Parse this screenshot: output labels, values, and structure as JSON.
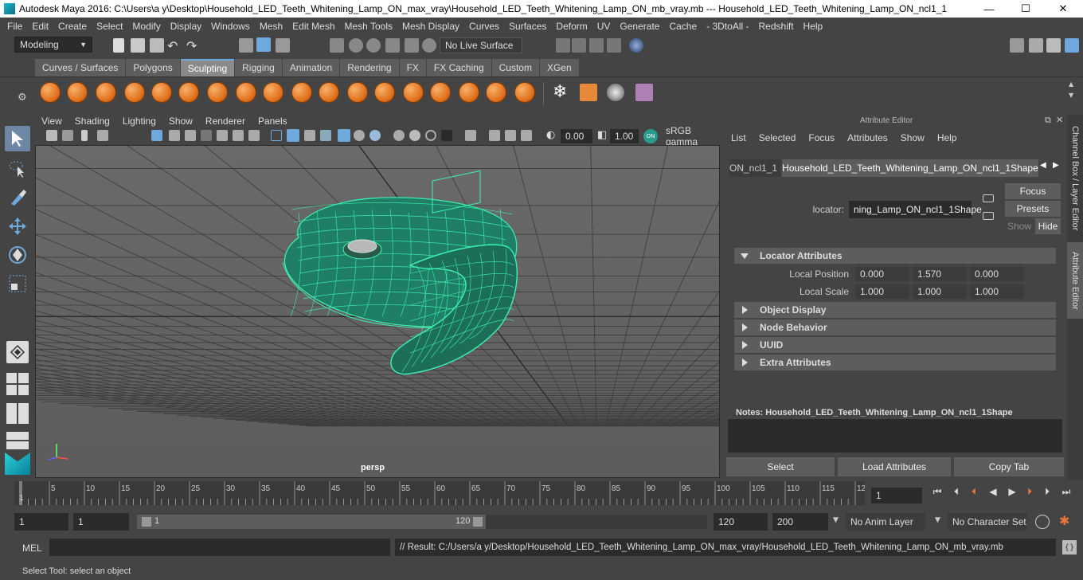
{
  "app": {
    "title": "Autodesk Maya 2016: C:\\Users\\a y\\Desktop\\Household_LED_Teeth_Whitening_Lamp_ON_max_vray\\Household_LED_Teeth_Whitening_Lamp_ON_mb_vray.mb   ---   Household_LED_Teeth_Whitening_Lamp_ON_ncl1_1",
    "minimize": "—",
    "maximize": "☐",
    "close": "✕"
  },
  "menu": [
    "File",
    "Edit",
    "Create",
    "Select",
    "Modify",
    "Display",
    "Windows",
    "Mesh",
    "Edit Mesh",
    "Mesh Tools",
    "Mesh Display",
    "Curves",
    "Surfaces",
    "Deform",
    "UV",
    "Generate",
    "Cache",
    "- 3DtoAll -",
    "Redshift",
    "Help"
  ],
  "status_line": {
    "menu_set": "Modeling",
    "live_surface": "No Live Surface"
  },
  "shelf_tabs": [
    {
      "label": "Curves / Surfaces",
      "active": false
    },
    {
      "label": "Polygons",
      "active": false
    },
    {
      "label": "Sculpting",
      "active": true
    },
    {
      "label": "Rigging",
      "active": false
    },
    {
      "label": "Animation",
      "active": false
    },
    {
      "label": "Rendering",
      "active": false
    },
    {
      "label": "FX",
      "active": false
    },
    {
      "label": "FX Caching",
      "active": false
    },
    {
      "label": "Custom",
      "active": false
    },
    {
      "label": "XGen",
      "active": false
    }
  ],
  "panel_menu": [
    "View",
    "Shading",
    "Lighting",
    "Show",
    "Renderer",
    "Panels"
  ],
  "panel_toolbar": {
    "exposure": "0.00",
    "gamma": "1.00",
    "color_space": "sRGB gamma",
    "cm_badge": "ON"
  },
  "viewport": {
    "camera_label": "persp",
    "wire_color": "#3ef2b4"
  },
  "attribute_editor": {
    "title": "Attribute Editor",
    "menu": [
      "List",
      "Selected",
      "Focus",
      "Attributes",
      "Show",
      "Help"
    ],
    "tab_left": "ON_ncl1_1",
    "tab_active": "Household_LED_Teeth_Whitening_Lamp_ON_ncl1_1Shape",
    "locator_label": "locator:",
    "locator_value": "ning_Lamp_ON_ncl1_1Shape",
    "focus_btn": "Focus",
    "presets_btn": "Presets",
    "show_btn": "Show",
    "hide_btn": "Hide",
    "sections": {
      "locator_attributes": "Locator Attributes",
      "object_display": "Object Display",
      "node_behavior": "Node Behavior",
      "uuid": "UUID",
      "extra_attributes": "Extra Attributes"
    },
    "local_position": {
      "label": "Local Position",
      "x": "0.000",
      "y": "1.570",
      "z": "0.000"
    },
    "local_scale": {
      "label": "Local Scale",
      "x": "1.000",
      "y": "1.000",
      "z": "1.000"
    },
    "notes_label": "Notes:  Household_LED_Teeth_Whitening_Lamp_ON_ncl1_1Shape",
    "select_btn": "Select",
    "load_btn": "Load Attributes",
    "copy_btn": "Copy Tab"
  },
  "side_tabs": {
    "channel_box": "Channel Box / Layer Editor",
    "attribute_editor": "Attribute Editor"
  },
  "time_slider": {
    "ticks": [
      "5",
      "10",
      "15",
      "20",
      "25",
      "30",
      "35",
      "40",
      "45",
      "50",
      "55",
      "60",
      "65",
      "70",
      "75",
      "80",
      "85",
      "90",
      "95",
      "100",
      "105",
      "110",
      "115",
      "12"
    ],
    "first": "1",
    "current_frame": "1"
  },
  "range_slider": {
    "start": "1",
    "playback_start": "1",
    "range_left": "1",
    "range_right": "120",
    "playback_end": "120",
    "end": "200",
    "anim_layer": "No Anim Layer",
    "character_set": "No Character Set"
  },
  "command_line": {
    "lang": "MEL",
    "result": "// Result: C:/Users/a y/Desktop/Household_LED_Teeth_Whitening_Lamp_ON_max_vray/Household_LED_Teeth_Whitening_Lamp_ON_mb_vray.mb"
  },
  "help_line": "Select Tool: select an object"
}
